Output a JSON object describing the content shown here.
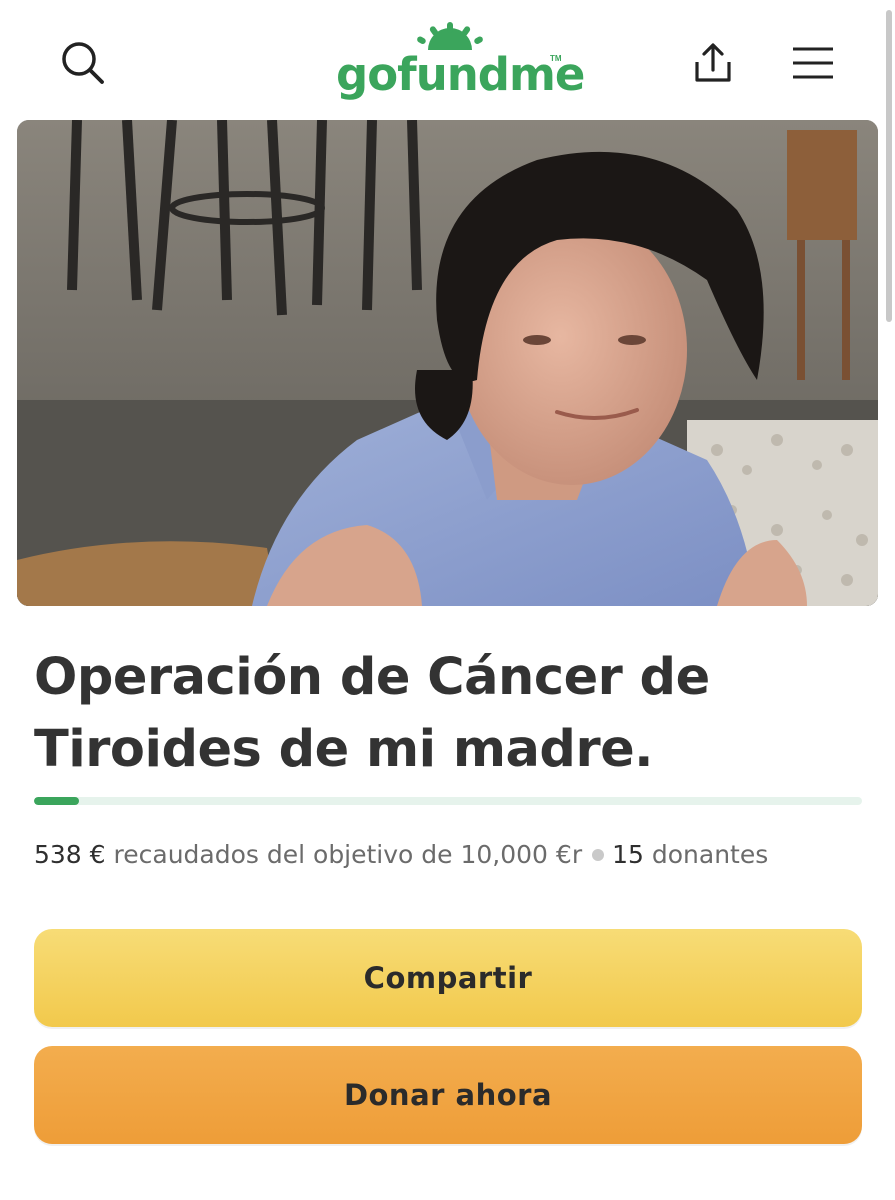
{
  "header": {
    "logo_text": "gofundme",
    "logo_tm": "TM",
    "icons": {
      "search": "search-icon",
      "share": "share-icon",
      "menu": "menu-icon"
    }
  },
  "campaign": {
    "title": "Operación de Cáncer de Tiroides de mi madre.",
    "progress_fraction": 0.0538,
    "raised": "538 €",
    "raised_text": "recaudados del objetivo de 10,000 €r",
    "donors_count": "15",
    "donors_label": "donantes"
  },
  "actions": {
    "share_label": "Compartir",
    "donate_label": "Donar ahora"
  },
  "colors": {
    "brand_green": "#3ba55c",
    "share_button": "#f2c94c",
    "donate_button": "#ee9d38"
  }
}
